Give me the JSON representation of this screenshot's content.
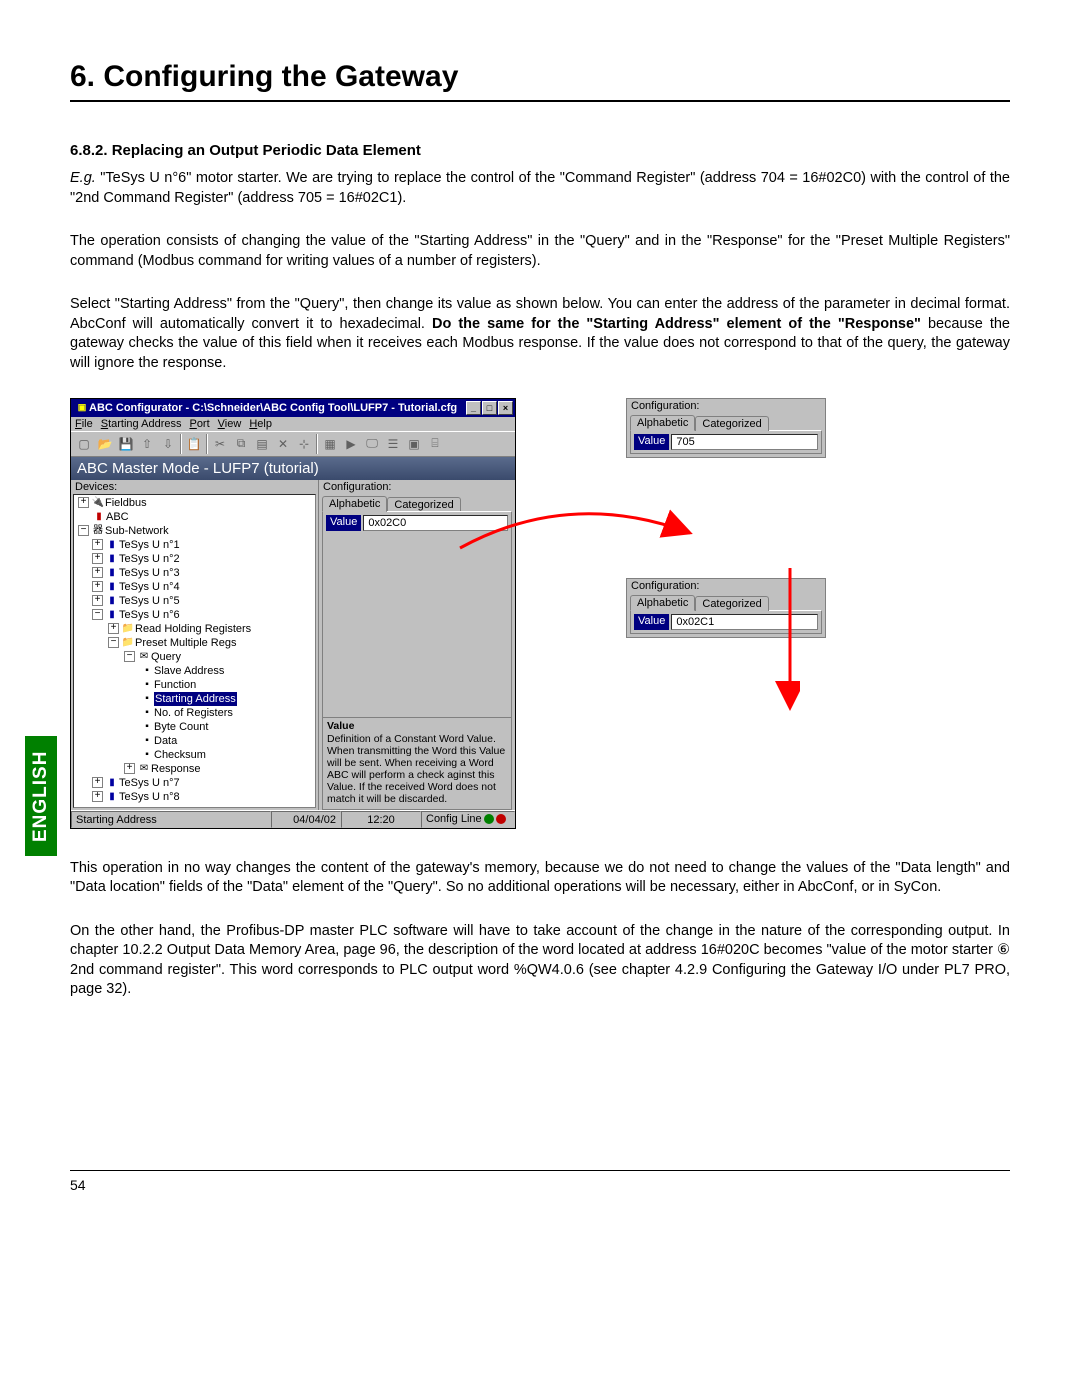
{
  "page": {
    "chapter_title": "6. Configuring the Gateway",
    "section_title": "6.8.2. Replacing an Output Periodic Data Element",
    "page_number": "54",
    "english_tab": "ENGLISH"
  },
  "paras": {
    "p1_eg": "E.g.",
    "p1_rest": " \"TeSys U n°6\" motor starter. We are trying to replace the control of the \"Command Register\" (address 704 = 16#02C0) with the control of the \"2nd Command Register\" (address 705 = 16#02C1).",
    "p2": "The operation consists of changing the value of the \"Starting Address\" in the \"Query\" and in the \"Response\" for the \"Preset Multiple Registers\" command (Modbus command for writing values of a number of registers).",
    "p3_a": "Select \"Starting Address\" from the \"Query\", then change its value as shown below. You can enter the address of the parameter in decimal format. AbcConf will automatically convert it to hexadecimal. ",
    "p3_b": "Do the same for the \"Starting Address\" element of the \"Response\"",
    "p3_c": " because the gateway checks the value of this field when it receives each Modbus response. If the value does not correspond to that of the query, the gateway will ignore the response.",
    "p4": "This operation in no way changes the content of the gateway's memory, because we do not need to change the values of the \"Data length\" and \"Data location\" fields of the \"Data\" element of the \"Query\". So no additional operations will be necessary, either in AbcConf, or in SyCon.",
    "p5": "On the other hand, the Profibus-DP master PLC software will have to take account of the change in the nature of the corresponding output. In chapter 10.2.2 Output Data Memory Area, page 96, the description of the word located at address 16#020C becomes \"value of the motor starter ⑥ 2nd command register\". This word corresponds to PLC output word %QW4.0.6 (see chapter 4.2.9 Configuring the Gateway I/O under PL7 PRO, page 32)."
  },
  "app": {
    "title": "ABC Configurator - C:\\Schneider\\ABC Config Tool\\LUFP7 - Tutorial.cfg",
    "menu": {
      "file": "File",
      "starting": "Starting Address",
      "port": "Port",
      "view": "View",
      "help": "Help"
    },
    "mode_bar": "ABC Master Mode - LUFP7 (tutorial)",
    "devices_label": "Devices:",
    "config_label": "Configuration:",
    "tab_alpha": "Alphabetic",
    "tab_cat": "Categorized",
    "value_label": "Value",
    "value_val": "0x02C0",
    "desc_title": "Value",
    "desc_body": "Definition of a Constant Word Value. When transmitting the Word this Value will be sent. When receiving a Word ABC will perform a check aginst this Value. If the received Word does not match it will be discarded.",
    "status": {
      "left": "Starting Address",
      "date": "04/04/02",
      "time": "12:20",
      "cfg": "Config Line"
    }
  },
  "tree": {
    "fieldbus": "Fieldbus",
    "abc": "ABC",
    "subnet": "Sub-Network",
    "n1": "TeSys U n°1",
    "n2": "TeSys U n°2",
    "n3": "TeSys U n°3",
    "n4": "TeSys U n°4",
    "n5": "TeSys U n°5",
    "n6": "TeSys U n°6",
    "rhr": "Read Holding Registers",
    "pmr": "Preset Multiple Regs",
    "query": "Query",
    "slave": "Slave Address",
    "function": "Function",
    "starting": "Starting Address",
    "noreg": "No. of Registers",
    "bytecount": "Byte Count",
    "data": "Data",
    "checksum": "Checksum",
    "response": "Response",
    "n7": "TeSys U n°7",
    "n8": "TeSys U n°8"
  },
  "side": {
    "top": {
      "config_label": "Configuration:",
      "tab_alpha": "Alphabetic",
      "tab_cat": "Categorized",
      "value_label": "Value",
      "value_val": "705"
    },
    "bottom": {
      "config_label": "Configuration:",
      "tab_alpha": "Alphabetic",
      "tab_cat": "Categorized",
      "value_label": "Value",
      "value_val": "0x02C1"
    }
  }
}
